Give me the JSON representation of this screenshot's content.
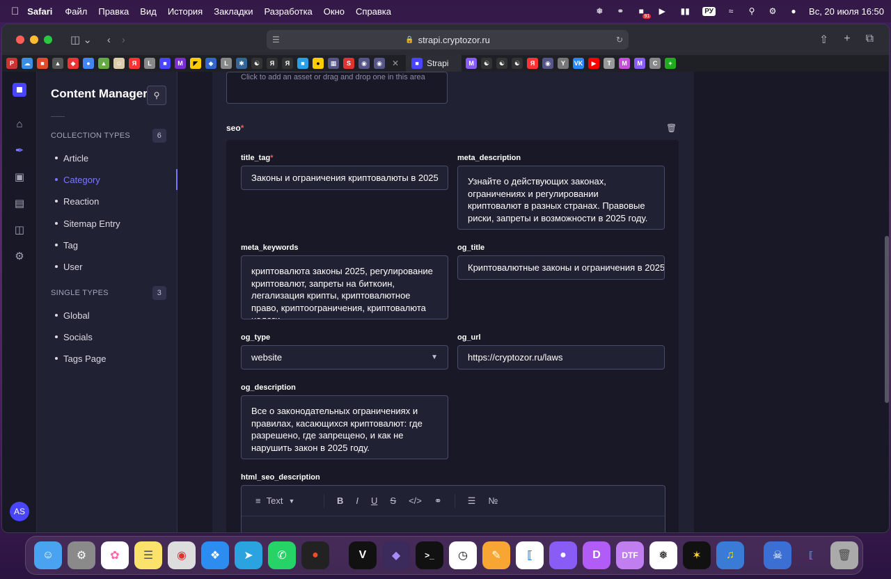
{
  "menubar": {
    "app": "Safari",
    "items": [
      "Файл",
      "Правка",
      "Вид",
      "История",
      "Закладки",
      "Разработка",
      "Окно",
      "Справка"
    ],
    "lang": "РУ",
    "datetime": "Вс, 20 июля  16:50",
    "badge": "91"
  },
  "browser": {
    "url": "strapi.cryptozor.ru",
    "active_tab": "Strapi"
  },
  "sidebar": {
    "title": "Content Manager",
    "collection_label": "COLLECTION TYPES",
    "collection_count": "6",
    "collection_items": [
      "Article",
      "Category",
      "Reaction",
      "Sitemap Entry",
      "Tag",
      "User"
    ],
    "single_label": "SINGLE TYPES",
    "single_count": "3",
    "single_items": [
      "Global",
      "Socials",
      "Tags Page"
    ],
    "avatar": "AS"
  },
  "form": {
    "upload_hint": "Click to add an asset or drag and drop one in this area",
    "seo_label": "seo",
    "title_tag_label": "title_tag",
    "title_tag_value": "Законы и ограничения криптовалюты в 2025",
    "meta_description_label": "meta_description",
    "meta_description_value": "Узнайте о действующих законах, ограничениях и регулировании криптовалют в разных странах. Правовые риски, запреты и возможности в 2025 году.",
    "meta_keywords_label": "meta_keywords",
    "meta_keywords_value": "криптовалюта законы 2025, регулирование криптовалют, запреты на биткоин, легализация крипты, криптовалютное право, криптоограничения, криптовалюта налоги",
    "og_title_label": "og_title",
    "og_title_value": "Криптовалютные законы и ограничения в 2025",
    "og_type_label": "og_type",
    "og_type_value": "website",
    "og_url_label": "og_url",
    "og_url_value": "https://cryptozor.ru/laws",
    "og_description_label": "og_description",
    "og_description_value": "Все о законодательных ограничениях и правилах, касающихся криптовалют: где разрешено, где запрещено, и как не нарушить закон в 2025 году.",
    "html_seo_description_label": "html_seo_description",
    "editor_format": "Text"
  },
  "dock": {
    "dtf_label": "DTF"
  },
  "colors": {
    "accent": "#7b79ff",
    "required": "#ee5e52",
    "panel": "#212134",
    "bg": "#181826"
  }
}
